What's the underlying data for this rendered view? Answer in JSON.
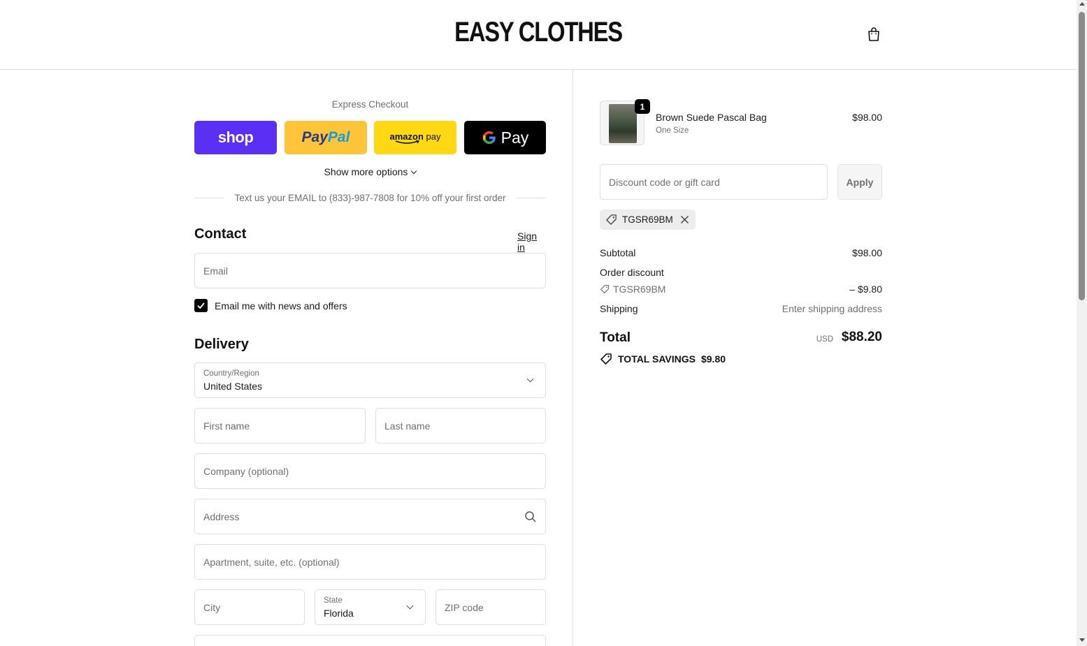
{
  "header": {
    "logo": "EASY CLOTHES",
    "cart_icon": "shopping-bag-icon"
  },
  "express": {
    "label": "Express Checkout",
    "buttons": {
      "shop": "shop",
      "paypal_a": "Pay",
      "paypal_b": "Pal",
      "amazon_a": "amazon",
      "amazon_b": "pay",
      "gpay_g": "G",
      "gpay_text": "Pay"
    },
    "show_more": "Show more options",
    "promo": "Text us your EMAIL to (833)-987-7808 for 10% off your first order"
  },
  "contact": {
    "title": "Contact",
    "sign_in": "Sign in",
    "email_placeholder": "Email",
    "newsletter_label": "Email me with news and offers",
    "newsletter_checked": true
  },
  "delivery": {
    "title": "Delivery",
    "country_label": "Country/Region",
    "country_value": "United States",
    "first_name_placeholder": "First name",
    "last_name_placeholder": "Last name",
    "company_placeholder": "Company (optional)",
    "address_placeholder": "Address",
    "apartment_placeholder": "Apartment, suite, etc. (optional)",
    "city_placeholder": "City",
    "state_label": "State",
    "state_value": "Florida",
    "zip_placeholder": "ZIP code"
  },
  "order": {
    "item": {
      "name": "Brown Suede Pascal Bag",
      "variant": "One Size",
      "price": "$98.00",
      "quantity": "1"
    },
    "discount_placeholder": "Discount code or gift card",
    "apply_label": "Apply",
    "applied_code": "TGSR69BM",
    "subtotal_label": "Subtotal",
    "subtotal_value": "$98.00",
    "order_discount_label": "Order discount",
    "discount_code": "TGSR69BM",
    "discount_value": "– $9.80",
    "shipping_label": "Shipping",
    "shipping_value": "Enter shipping address",
    "total_label": "Total",
    "currency": "USD",
    "total_value": "$88.20",
    "savings_label": "TOTAL SAVINGS",
    "savings_value": "$9.80"
  },
  "colors": {
    "shop": "#5a31f4",
    "paypal": "#ffc439",
    "amazon": "#ffd814",
    "gpay": "#000000",
    "border": "#dedede",
    "muted": "#707070"
  }
}
